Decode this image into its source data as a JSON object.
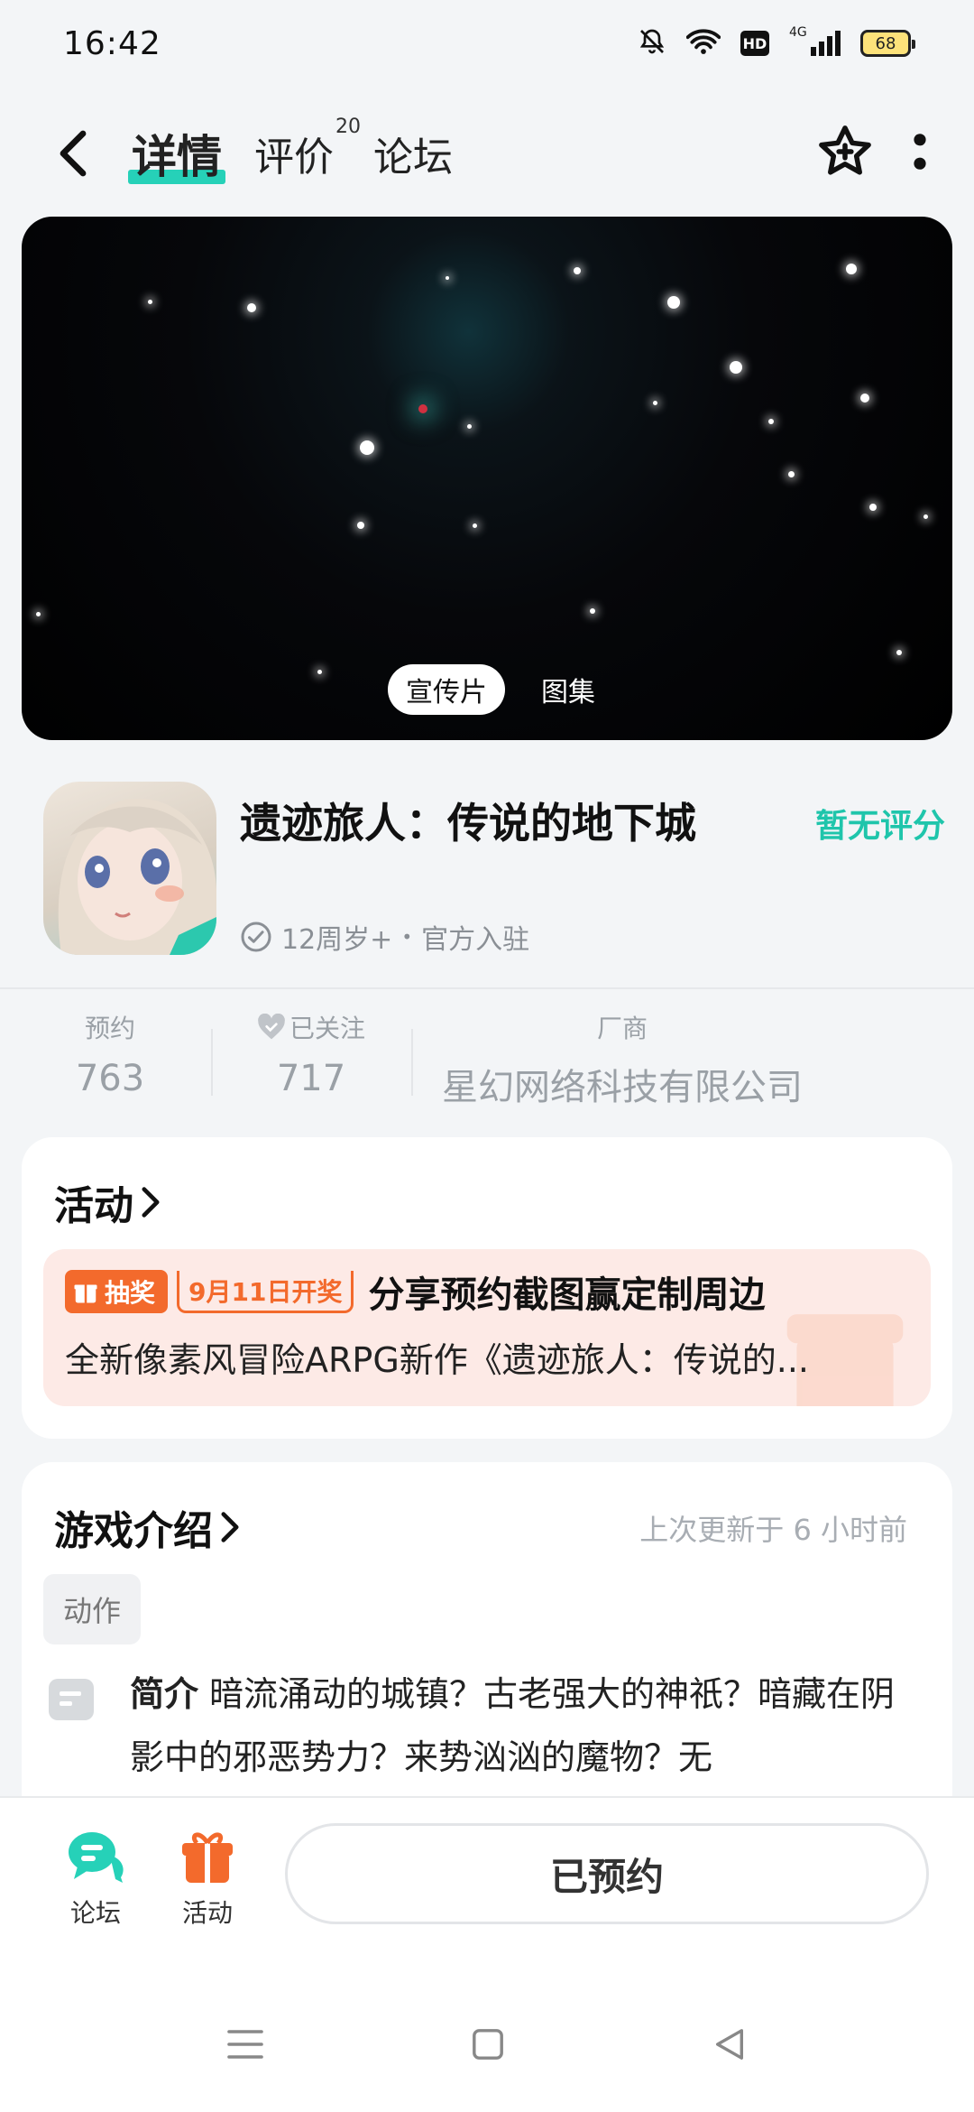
{
  "status_bar": {
    "time": "16:42",
    "network": "4G",
    "hd_label": "HD",
    "battery": "68"
  },
  "nav": {
    "tabs": [
      {
        "label": "详情",
        "active": true
      },
      {
        "label": "评价",
        "count": "20"
      },
      {
        "label": "论坛"
      }
    ]
  },
  "media": {
    "tabs": [
      "宣传片",
      "图集"
    ],
    "selected": "宣传片"
  },
  "game": {
    "title": "遗迹旅人：传说的地下城",
    "score_text": "暂无评分",
    "age_rating": "12周岁+",
    "separator": "•",
    "official": "官方入驻"
  },
  "stats": {
    "reserve_label": "预约",
    "reserve_count": "763",
    "follow_label": "已关注",
    "follow_count": "717",
    "vendor_label": "厂商",
    "vendor_name": "星幻网络科技有限公司"
  },
  "activity_card": {
    "title": "活动",
    "badge": "抽奖",
    "date_tag": "9月11日开奖",
    "headline": "分享预约截图赢定制周边",
    "description": "全新像素风冒险ARPG新作《遗迹旅人：传说的..."
  },
  "intro_card": {
    "title": "游戏介绍",
    "updated": "上次更新于 6 小时前",
    "genre": "动作",
    "summary_label": "简介",
    "summary_text": "暗流涌动的城镇？古老强大的神祇？暗藏在阴影中的邪恶势力？来势汹汹的魔物？无"
  },
  "bottom_bar": {
    "forum_label": "论坛",
    "activity_label": "活动",
    "reserve_button": "已预约"
  },
  "colors": {
    "accent": "#26d1b8",
    "score": "#1fc5ab",
    "lottery": "#f36a2c",
    "activity_bg": "#fdeae6"
  }
}
